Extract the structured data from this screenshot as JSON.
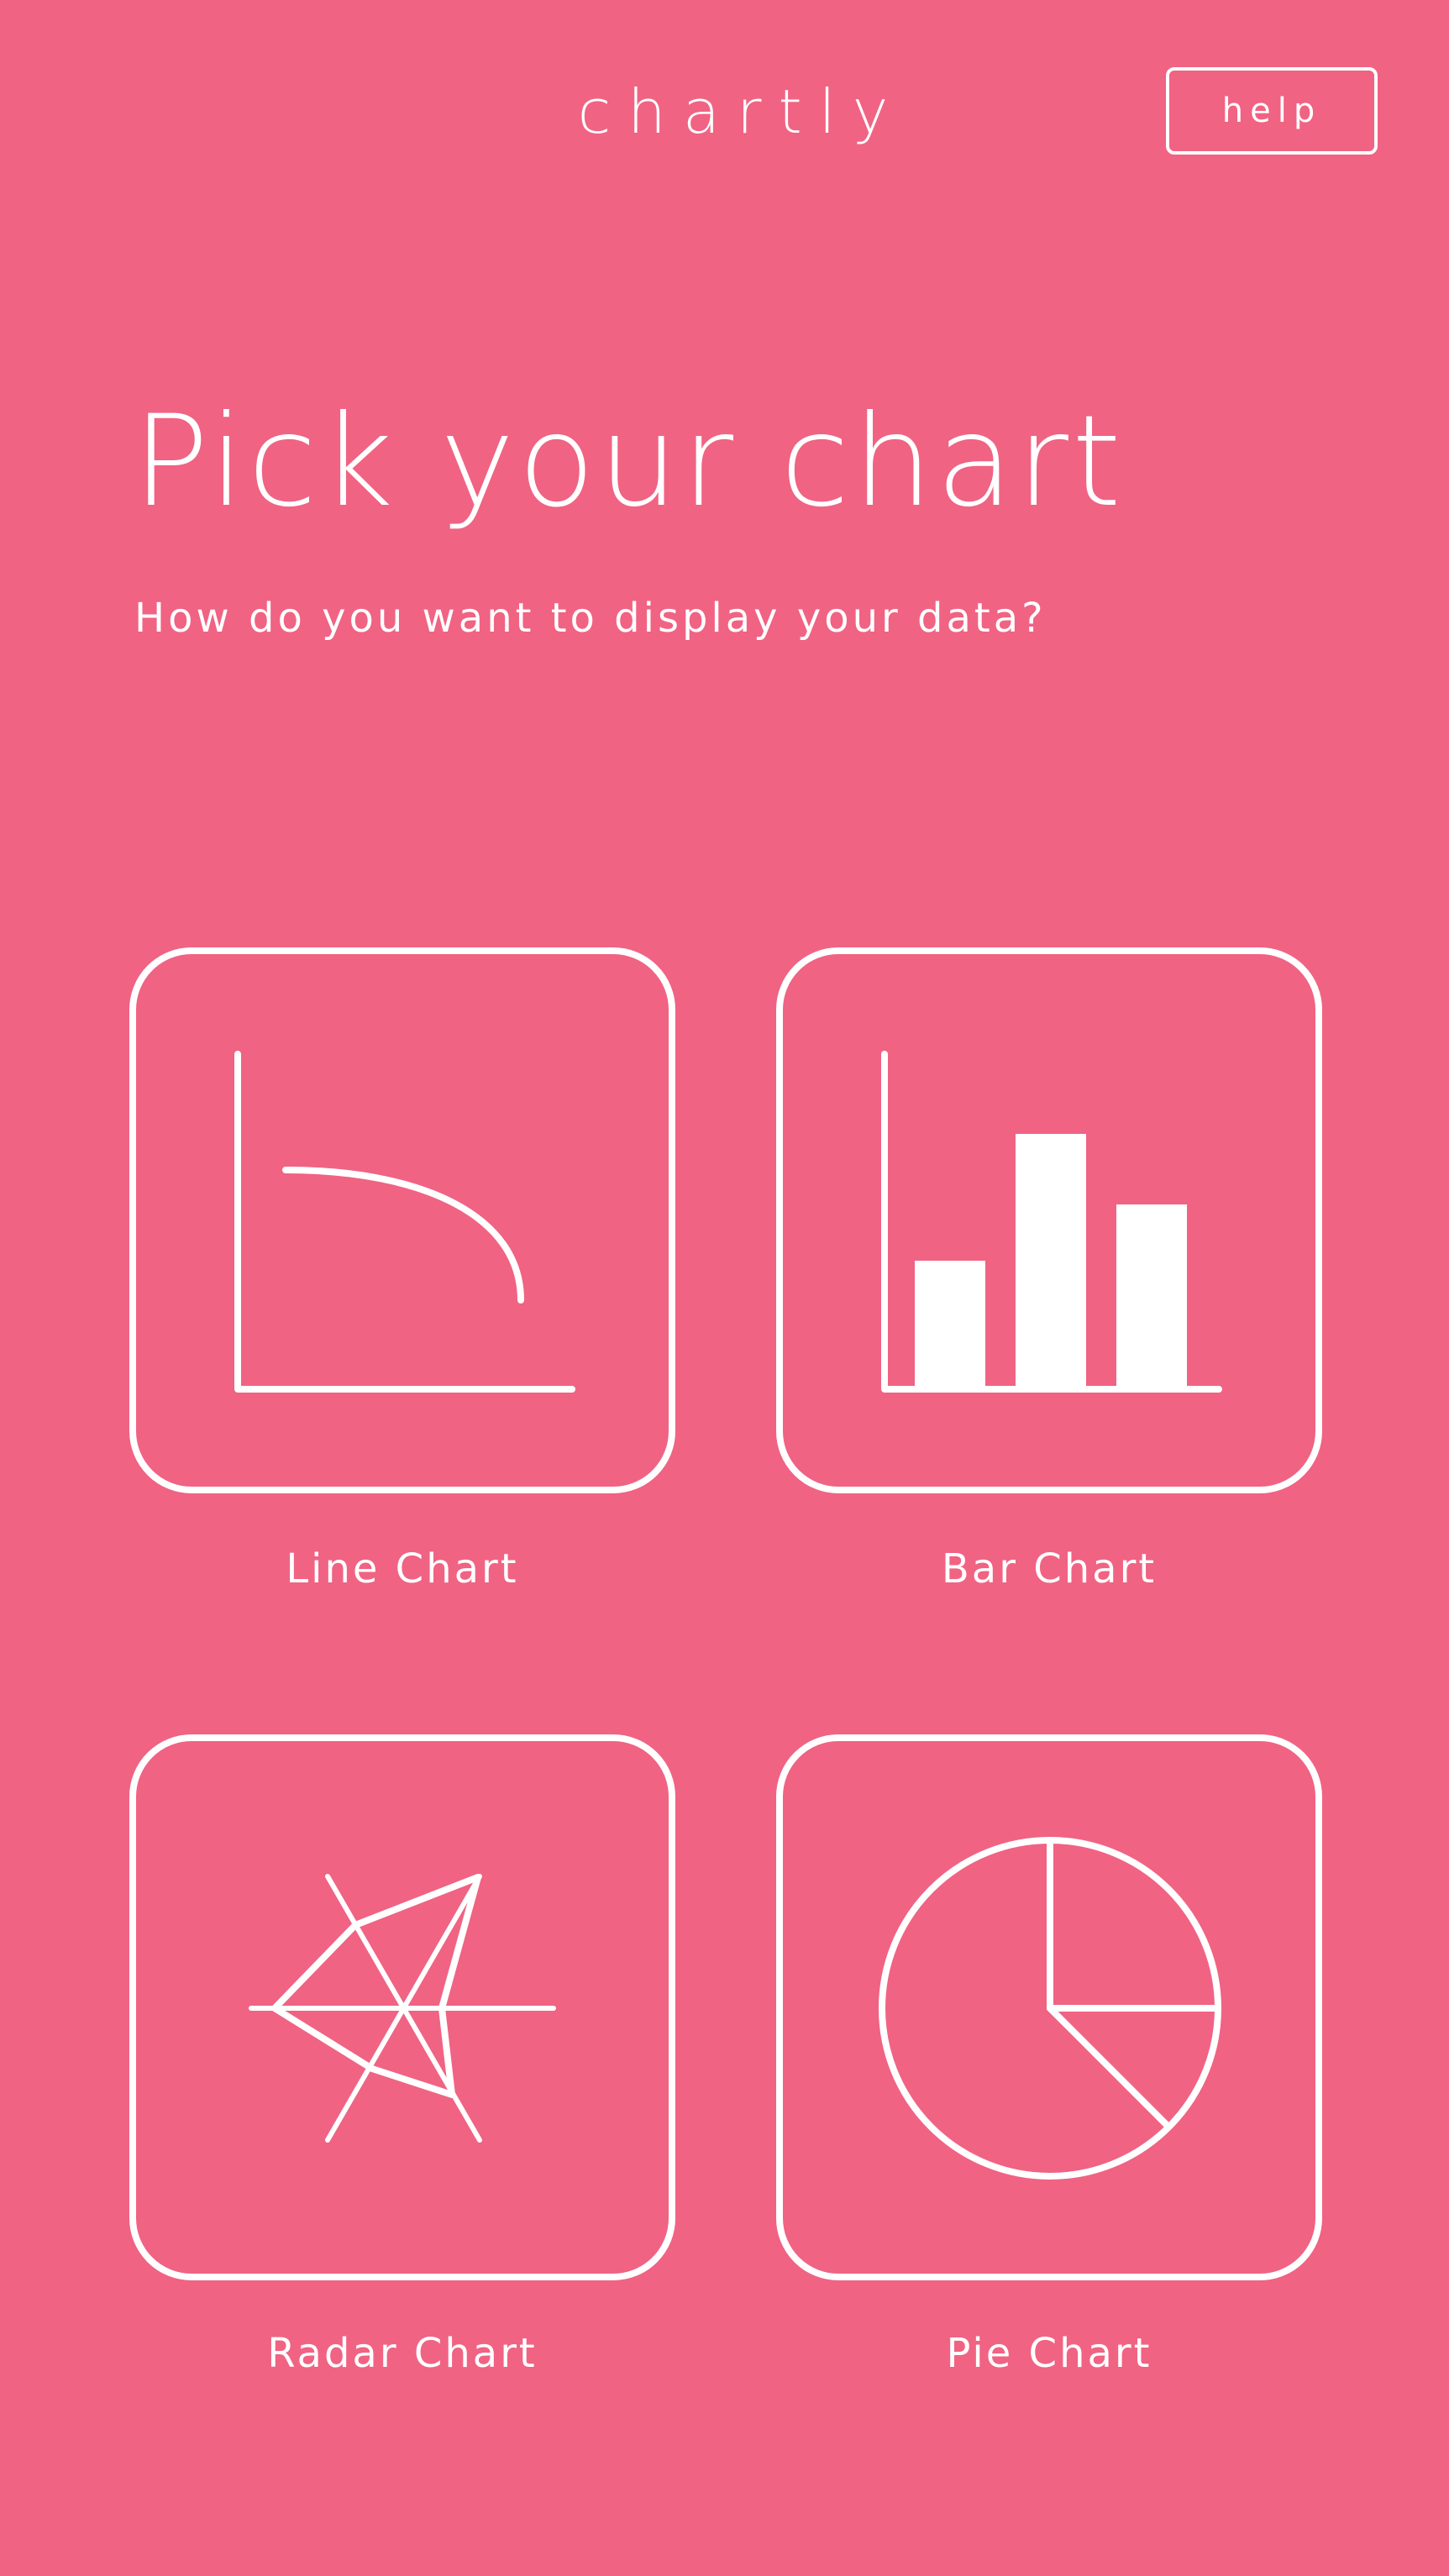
{
  "header": {
    "logo": "chartly",
    "help_label": "help"
  },
  "main": {
    "title": "Pick your chart",
    "subtitle": "How do you want to display your data?"
  },
  "chart_options": [
    {
      "label": "Line Chart",
      "icon": "line-chart-icon"
    },
    {
      "label": "Bar Chart",
      "icon": "bar-chart-icon"
    },
    {
      "label": "Radar Chart",
      "icon": "radar-chart-icon"
    },
    {
      "label": "Pie Chart",
      "icon": "pie-chart-icon"
    }
  ],
  "colors": {
    "background": "#F06383",
    "foreground": "#FFFFFF"
  }
}
